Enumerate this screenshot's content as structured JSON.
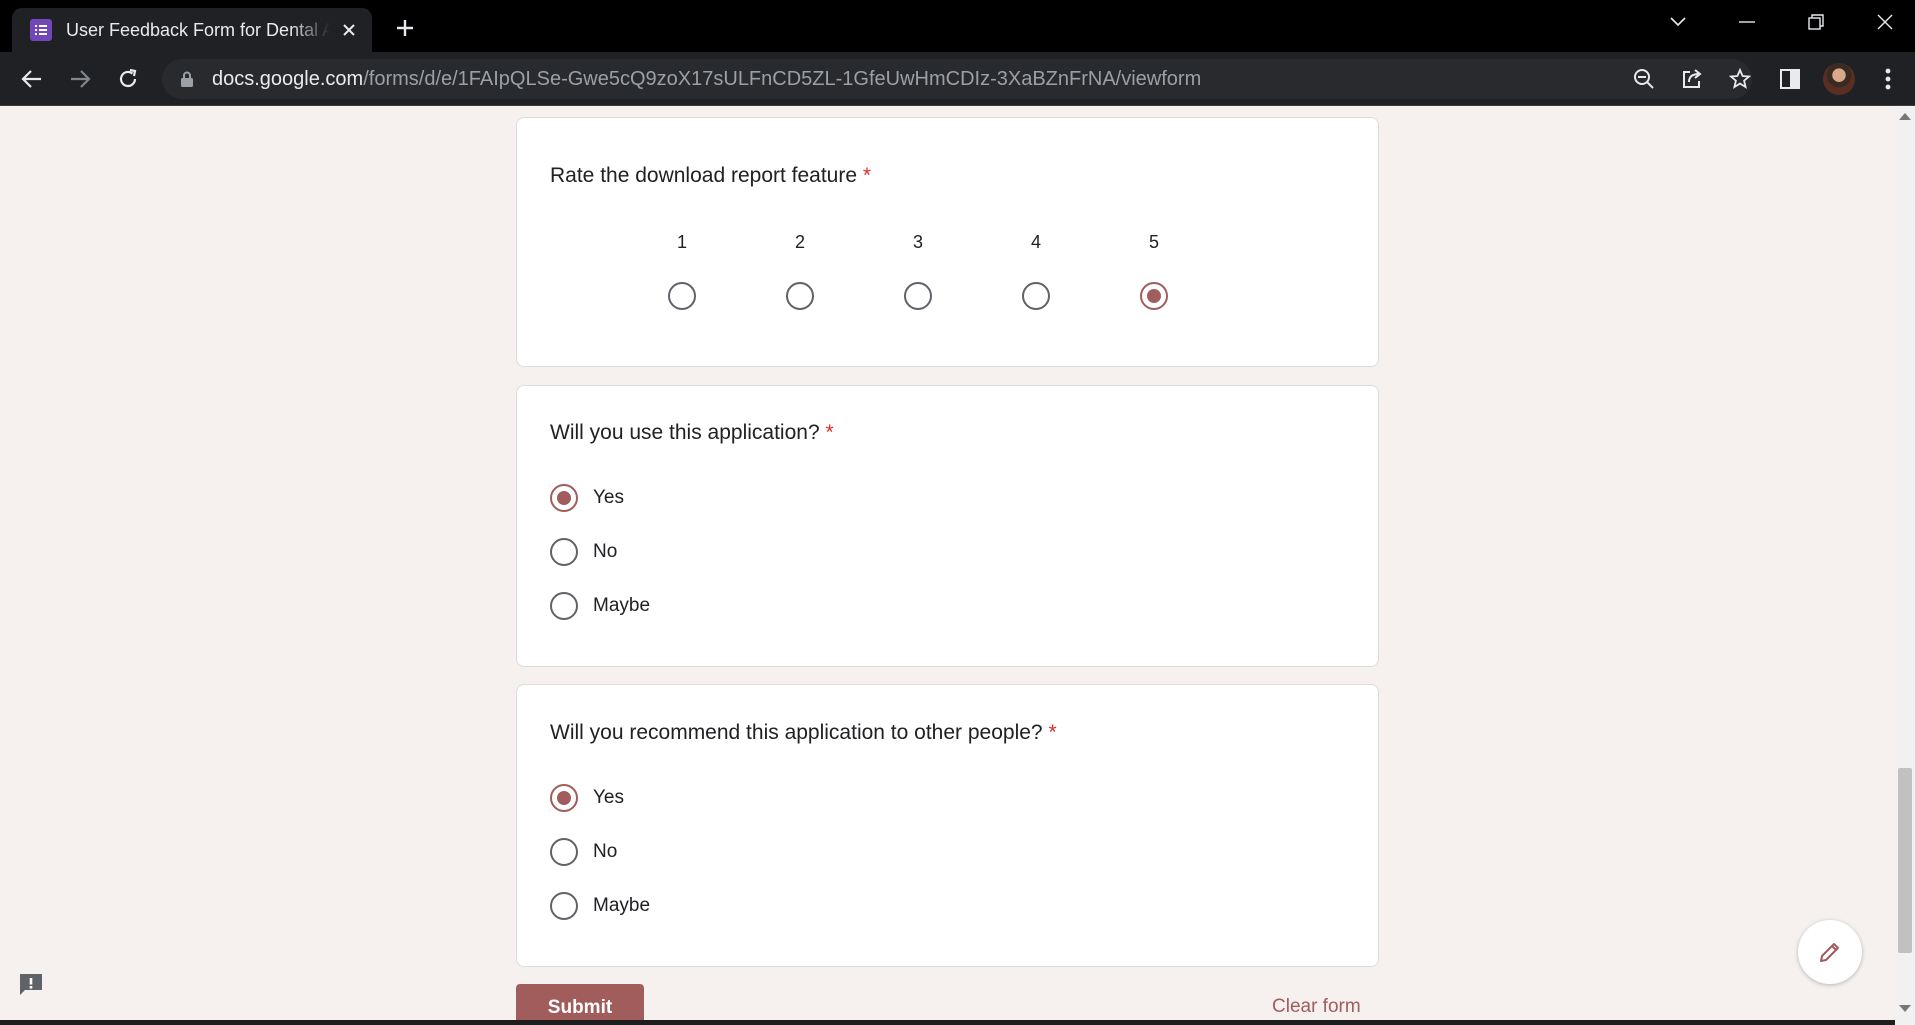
{
  "browser": {
    "tab_title": "User Feedback Form for Dental Application",
    "url_host": "docs.google.com",
    "url_path": "/forms/d/e/1FAIpQLSe-Gwe5cQ9zoX17sULFnCD5ZL-1GfeUwHmCDIz-3XaBZnFrNA/viewform",
    "icons": [
      "form-favicon-icon",
      "close-icon",
      "plus-icon",
      "chevron-down-icon",
      "minimize-icon",
      "restore-icon",
      "close-window-icon",
      "back-icon",
      "forward-icon",
      "reload-icon",
      "lock-icon",
      "zoom-out-icon",
      "share-icon",
      "star-icon",
      "side-panel-icon",
      "profile-avatar",
      "menu-icon"
    ]
  },
  "form": {
    "questions": [
      {
        "title": "Rate the download report feature",
        "required_mark": "*",
        "type": "linear-scale",
        "scale": [
          "1",
          "2",
          "3",
          "4",
          "5"
        ],
        "selected": "5"
      },
      {
        "title": "Will you use this application?",
        "required_mark": "*",
        "type": "multiple-choice",
        "options": [
          "Yes",
          "No",
          "Maybe"
        ],
        "selected": "Yes"
      },
      {
        "title": "Will you recommend this application to other people?",
        "required_mark": "*",
        "type": "multiple-choice",
        "options": [
          "Yes",
          "No",
          "Maybe"
        ],
        "selected": "Yes"
      }
    ],
    "submit_label": "Submit",
    "clear_label": "Clear form",
    "accent_color": "#a15c5c",
    "required_color": "#d93025",
    "background_color": "#f6f0ef"
  }
}
